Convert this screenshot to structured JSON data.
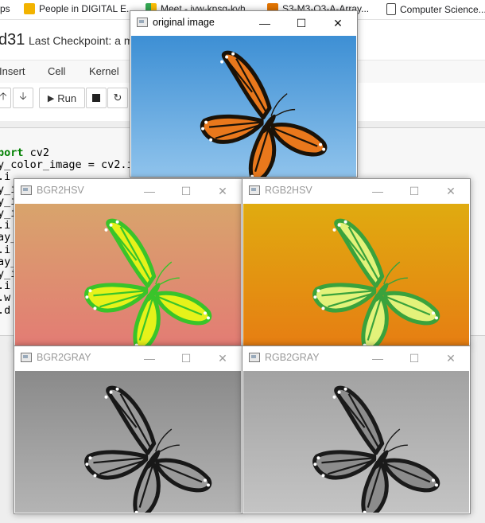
{
  "bookmarks": [
    {
      "label": "ps",
      "icon": "bookmark-icon"
    },
    {
      "label": "People in DIGITAL E...",
      "icon": "contacts-icon"
    },
    {
      "label": "Meet - jvw-kpsg-kvh",
      "icon": "meet-icon"
    },
    {
      "label": "S3-M3-O3-A-Array...",
      "icon": "doc-icon"
    },
    {
      "label": "Computer Science...",
      "icon": "page-icon"
    }
  ],
  "notebook": {
    "name": "d31",
    "checkpoint": "Last Checkpoint: a mi",
    "menu": [
      "Insert",
      "Cell",
      "Kernel"
    ],
    "run_label": "Run",
    "code_lines": [
      "port cv2",
      "y_color_image = cv2.i",
      ".i",
      "y_i",
      "y_i",
      "y_i",
      ".i",
      "ay_",
      ".i",
      "ay_",
      "y_i",
      ".i",
      ".w",
      ".d"
    ]
  },
  "windows": {
    "original": {
      "title": "original image",
      "state": "active",
      "colors": {
        "bg_top": "#3d8fd4",
        "bg_bottom": "#8fc3ec",
        "wing": "#e9781c",
        "vein": "#1a1208"
      }
    },
    "bgr2hsv": {
      "title": "BGR2HSV",
      "state": "inactive",
      "colors": {
        "bg_top": "#d8a46c",
        "bg_bottom": "#e37c74",
        "wing": "#e6f21a",
        "vein": "#39c42a"
      }
    },
    "rgb2hsv": {
      "title": "RGB2HSV",
      "state": "inactive",
      "colors": {
        "bg_top": "#e0ab10",
        "bg_bottom": "#e67e12",
        "wing": "#e3f27a",
        "vein": "#3aa23c"
      }
    },
    "bgr2gray": {
      "title": "BGR2GRAY",
      "state": "inactive",
      "colors": {
        "bg_top": "#8a8a8a",
        "bg_bottom": "#b4b4b4",
        "wing": "#9a9a9a",
        "vein": "#181818"
      }
    },
    "rgb2gray": {
      "title": "RGB2GRAY",
      "state": "inactive",
      "colors": {
        "bg_top": "#a2a2a2",
        "bg_bottom": "#c4c4c4",
        "wing": "#8c8c8c",
        "vein": "#1a1a1a"
      }
    }
  },
  "window_controls": {
    "minimize": "—",
    "maximize": "☐",
    "close": "✕"
  }
}
